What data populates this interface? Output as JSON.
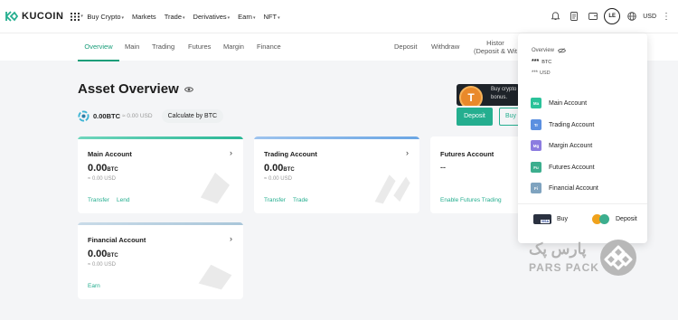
{
  "topnav": {
    "logo_text": "KUCOIN",
    "menu": [
      {
        "label": "Buy Crypto",
        "caret": true
      },
      {
        "label": "Markets",
        "caret": false
      },
      {
        "label": "Trade",
        "caret": true
      },
      {
        "label": "Derivatives",
        "caret": true
      },
      {
        "label": "Earn",
        "caret": true
      },
      {
        "label": "NFT",
        "caret": true
      }
    ],
    "avatar_initials": "LE",
    "currency": "USD",
    "more": "⋮"
  },
  "subnav": {
    "tabs": [
      "Overview",
      "Main",
      "Trading",
      "Futures",
      "Margin",
      "Finance"
    ],
    "deposit": "Deposit",
    "withdraw": "Withdraw",
    "history_line1": "Histor",
    "history_line2": "(Deposit & Wit"
  },
  "header": {
    "title": "Asset Overview",
    "balance_btc": "0.00BTC",
    "balance_usd": "≈ 0.00 USD",
    "calc_label": "Calculate by BTC"
  },
  "promo": {
    "coin": "T",
    "line1": "Buy crypto",
    "line2": "bonus."
  },
  "actions": {
    "deposit": "Deposit",
    "buy": "Buy"
  },
  "accounts": {
    "main": {
      "name": "Main Account",
      "amount": "0.00",
      "unit": "BTC",
      "fiat": "≈ 0.00 USD",
      "links": [
        "Transfer",
        "Lend"
      ]
    },
    "trading": {
      "name": "Trading Account",
      "amount": "0.00",
      "unit": "BTC",
      "fiat": "≈ 0.00 USD",
      "links": [
        "Transfer",
        "Trade"
      ]
    },
    "futures": {
      "name": "Futures Account",
      "amount": "--",
      "link": "Enable Futures Trading"
    },
    "financial": {
      "name": "Financial Account",
      "amount": "0.00",
      "unit": "BTC",
      "fiat": "≈ 0.00 USD",
      "links": [
        "Earn"
      ]
    }
  },
  "dropdown": {
    "overview": "Overview",
    "btc_mask": "***",
    "btc_unit": "BTC",
    "usd_mask": "***",
    "usd_unit": "USD",
    "items": [
      {
        "badge": "Ma",
        "label": "Main Account",
        "color": "#2bc29a"
      },
      {
        "badge": "Tr",
        "label": "Trading Account",
        "color": "#5b8fe0"
      },
      {
        "badge": "Mg",
        "label": "Margin Account",
        "color": "#8c7ce0"
      },
      {
        "badge": "Fu",
        "label": "Futures Account",
        "color": "#3cae8e"
      },
      {
        "badge": "Fi",
        "label": "Financial Account",
        "color": "#7fa3bf"
      }
    ],
    "buy": "Buy",
    "buy_card": "VISA",
    "deposit": "Deposit"
  },
  "watermark": {
    "fa": "پارس پک",
    "en": "PARS PACK"
  },
  "colors": {
    "accent": "#24ae8f",
    "text": "#1d1d1d",
    "page_bg": "#f4f5f7"
  }
}
